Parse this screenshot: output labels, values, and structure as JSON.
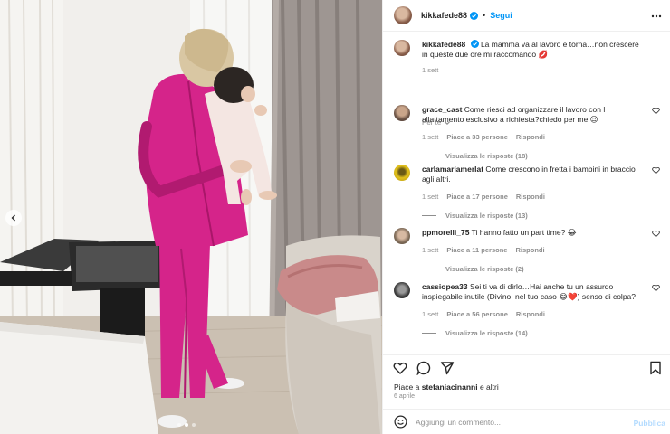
{
  "post": {
    "username": "kikkafede88",
    "follow_label": "Segui",
    "separator": "•"
  },
  "caption": {
    "username": "kikkafede88",
    "text": "La mamma va al lavoro e torna…non crescere in queste due ore mi raccomando",
    "emoji": "💋",
    "time": "1 sett"
  },
  "forte": {
    "label": "Per te"
  },
  "comments": [
    {
      "username": "grace_cast",
      "text": "Come riesci ad organizzare il lavoro con l allattamento esclusivo a richiesta?chiedo per me",
      "emoji": "😉",
      "time": "1 sett",
      "likes": "Piace a 33 persone",
      "reply": "Rispondi",
      "replies": "Visualizza le risposte (18)"
    },
    {
      "username": "carlamariamerlat",
      "text": "Come crescono in fretta i bambini in braccio agli altri.",
      "time": "1 sett",
      "likes": "Piace a 17 persone",
      "reply": "Rispondi",
      "replies": "Visualizza le risposte (13)"
    },
    {
      "username": "ppmorelli_75",
      "text": "Ti hanno fatto un part time?",
      "emoji": "😂",
      "time": "1 sett",
      "likes": "Piace a 11 persone",
      "reply": "Rispondi",
      "replies": "Visualizza le risposte (2)"
    },
    {
      "username": "cassiopea33",
      "text": "Sei ti va di dirlo…Hai anche tu un assurdo inspiegabile inutile (Divino, nel tuo caso",
      "emoji": "😂❤️",
      "text_after": ") senso di colpa?",
      "time": "1 sett",
      "likes": "Piace a 56 persone",
      "reply": "Rispondi",
      "replies": "Visualizza le risposte (14)"
    }
  ],
  "likes": {
    "prefix": "Piace a ",
    "user": "stefaniacinanni",
    "suffix": " e altri"
  },
  "date": "6 aprile",
  "composer": {
    "placeholder": "Aggiungi un commento...",
    "publish_label": "Pubblica"
  },
  "carousel": {
    "active_index": 1,
    "count": 3
  },
  "colors": {
    "accent": "#0095f6",
    "blazer": "#d5248a",
    "muted": "#8e8e8e"
  }
}
